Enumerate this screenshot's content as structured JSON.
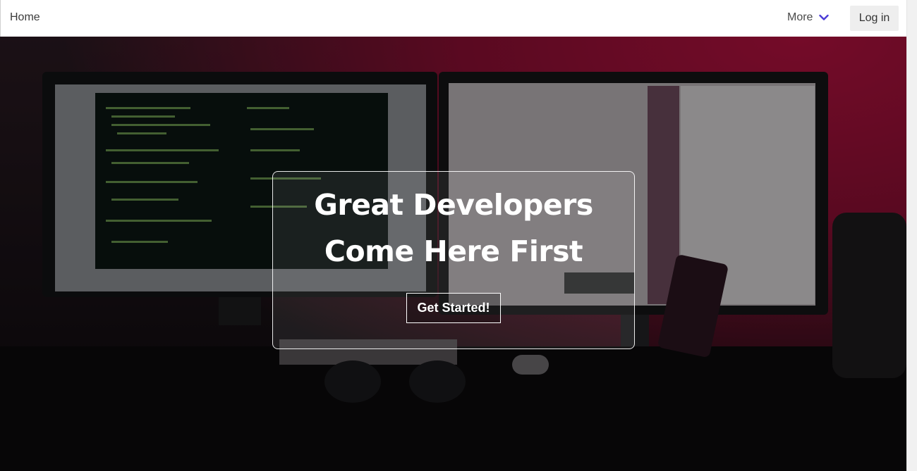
{
  "nav": {
    "home_label": "Home",
    "more_label": "More",
    "login_label": "Log in"
  },
  "hero": {
    "headline": "Great Developers Come Here First",
    "cta_label": "Get Started!"
  },
  "icons": {
    "more_chevron": "chevron-down-icon"
  },
  "colors": {
    "accent": "#4a3bd6",
    "hero_red": "#b3123f",
    "navbar_bg": "#ffffff"
  }
}
